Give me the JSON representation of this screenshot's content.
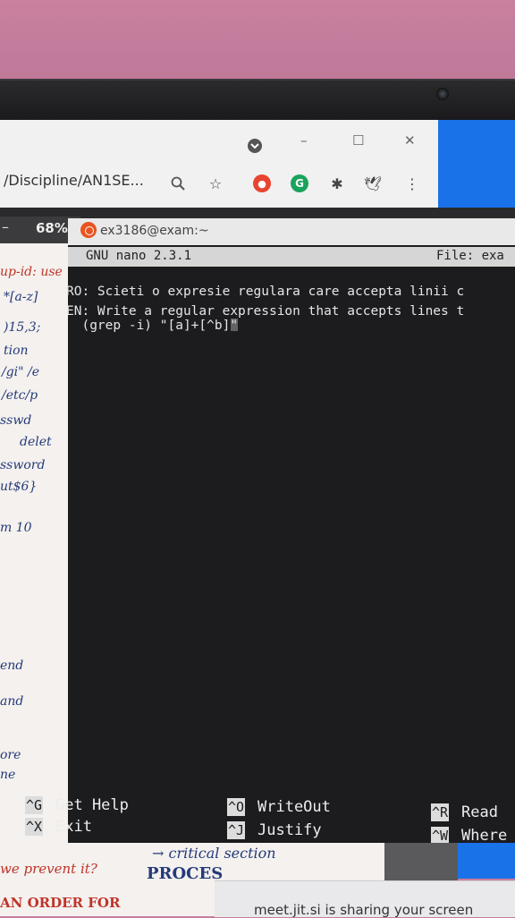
{
  "browser": {
    "new_tab": "+",
    "url": "/Discipline/AN1SE...",
    "window_controls": [
      "–",
      "☐",
      "✕"
    ]
  },
  "pdf": {
    "zoom": "68%",
    "dash": "–"
  },
  "terminal": {
    "title": "ex3186@exam:~",
    "nano_version": "GNU nano 2.3.1",
    "file_label": "File: exa",
    "lines": [
      "RO: Scieti o expresie regulara care accepta linii c",
      "EN: Write a regular expression that accepts lines t",
      "  (grep -i) \"[a]+[^b]\""
    ],
    "shortcuts": [
      {
        "key": "^G",
        "label": "Get Help"
      },
      {
        "key": "^X",
        "label": "Exit"
      },
      {
        "key": "^O",
        "label": "WriteOut"
      },
      {
        "key": "^J",
        "label": "Justify"
      },
      {
        "key": "^R",
        "label": "Read"
      },
      {
        "key": "^W",
        "label": "Where"
      }
    ]
  },
  "notes": {
    "left": [
      "up-id: use",
      "*[a-z]",
      ")15,3;",
      "tion",
      "/gi\" /e",
      "/etc/p",
      "sswd",
      "delet",
      "ssword",
      "ut$6}",
      "m 10",
      "end",
      "and",
      "ore",
      "ne"
    ],
    "bottom": [
      "→ critical section",
      "we prevent it?",
      "PROCES",
      "AN ORDER FOR"
    ]
  },
  "share_bar": {
    "text": "meet.jit.si is sharing your screen"
  }
}
